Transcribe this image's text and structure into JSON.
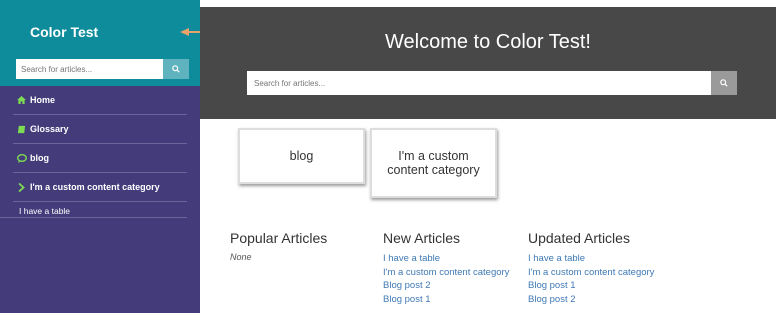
{
  "sidebar": {
    "brand": "Color Test",
    "search_placeholder": "Search for articles...",
    "items": [
      {
        "label": "Home",
        "icon": "home-icon"
      },
      {
        "label": "Glossary",
        "icon": "book-icon"
      },
      {
        "label": "blog",
        "icon": "chat-icon"
      },
      {
        "label": "I'm a custom content category",
        "icon": "chevron-right-icon"
      }
    ],
    "sub_items": [
      {
        "label": "I have a table"
      }
    ]
  },
  "header": {
    "title": "Welcome to Color Test!",
    "search_placeholder": "Search for articles..."
  },
  "categories": [
    {
      "label": "blog"
    },
    {
      "label": "I'm a custom content category"
    }
  ],
  "popular": {
    "heading": "Popular Articles",
    "empty": "None"
  },
  "new_articles": {
    "heading": "New Articles",
    "items": [
      "I have a table",
      "I'm a custom content category",
      "Blog post 2",
      "Blog post 1"
    ]
  },
  "updated_articles": {
    "heading": "Updated Articles",
    "items": [
      "I have a table",
      "I'm a custom content category",
      "Blog post 1",
      "Blog post 2"
    ]
  },
  "colors": {
    "sidebar_bg": "#443b7a",
    "sidebar_head_bg": "#0f8c9c",
    "header_bg": "#484848",
    "link": "#3f79b5",
    "icon_green": "#7ddc52",
    "arrow": "#e8a36b"
  }
}
